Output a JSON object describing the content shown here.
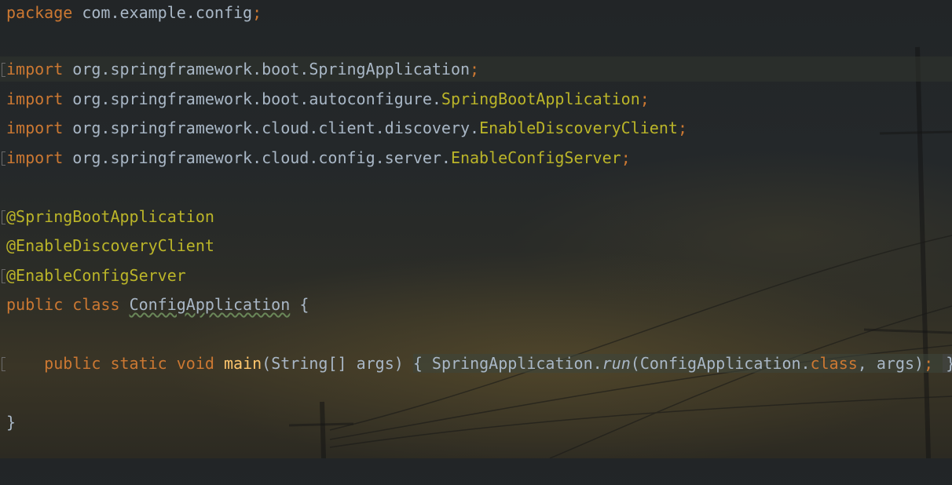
{
  "editor": {
    "lines": {
      "package": {
        "kw": "package",
        "name": "com.example.config",
        "semi": ";"
      },
      "import1": {
        "kw": "import",
        "pkg": "org.springframework.boot.",
        "cls": "SpringApplication",
        "semi": ";"
      },
      "import2": {
        "kw": "import",
        "pkg": "org.springframework.boot.autoconfigure.",
        "cls": "SpringBootApplication",
        "semi": ";"
      },
      "import3": {
        "kw": "import",
        "pkg": "org.springframework.cloud.client.discovery.",
        "cls": "EnableDiscoveryClient",
        "semi": ";"
      },
      "import4": {
        "kw": "import",
        "pkg": "org.springframework.cloud.config.server.",
        "cls": "EnableConfigServer",
        "semi": ";"
      },
      "ann1": "@SpringBootApplication",
      "ann2": "@EnableDiscoveryClient",
      "ann3": "@EnableConfigServer",
      "classDecl": {
        "kw1": "public",
        "kw2": "class",
        "name": "ConfigApplication",
        "brace": "{"
      },
      "main": {
        "kw1": "public",
        "kw2": "static",
        "kw3": "void",
        "name": "main",
        "params": "(String[] args)",
        "open": "{",
        "callCls": "SpringApplication.",
        "callFn": "run",
        "argOpen": "(ConfigApplication.",
        "argKw": "class",
        "argRest": ", args)",
        "semi": ";",
        "close": "}"
      },
      "closeBrace": "}"
    }
  },
  "colors": {
    "keyword": "#cc7832",
    "annotation": "#bbb529",
    "text": "#a9b7c6",
    "function": "#ffc66d"
  }
}
